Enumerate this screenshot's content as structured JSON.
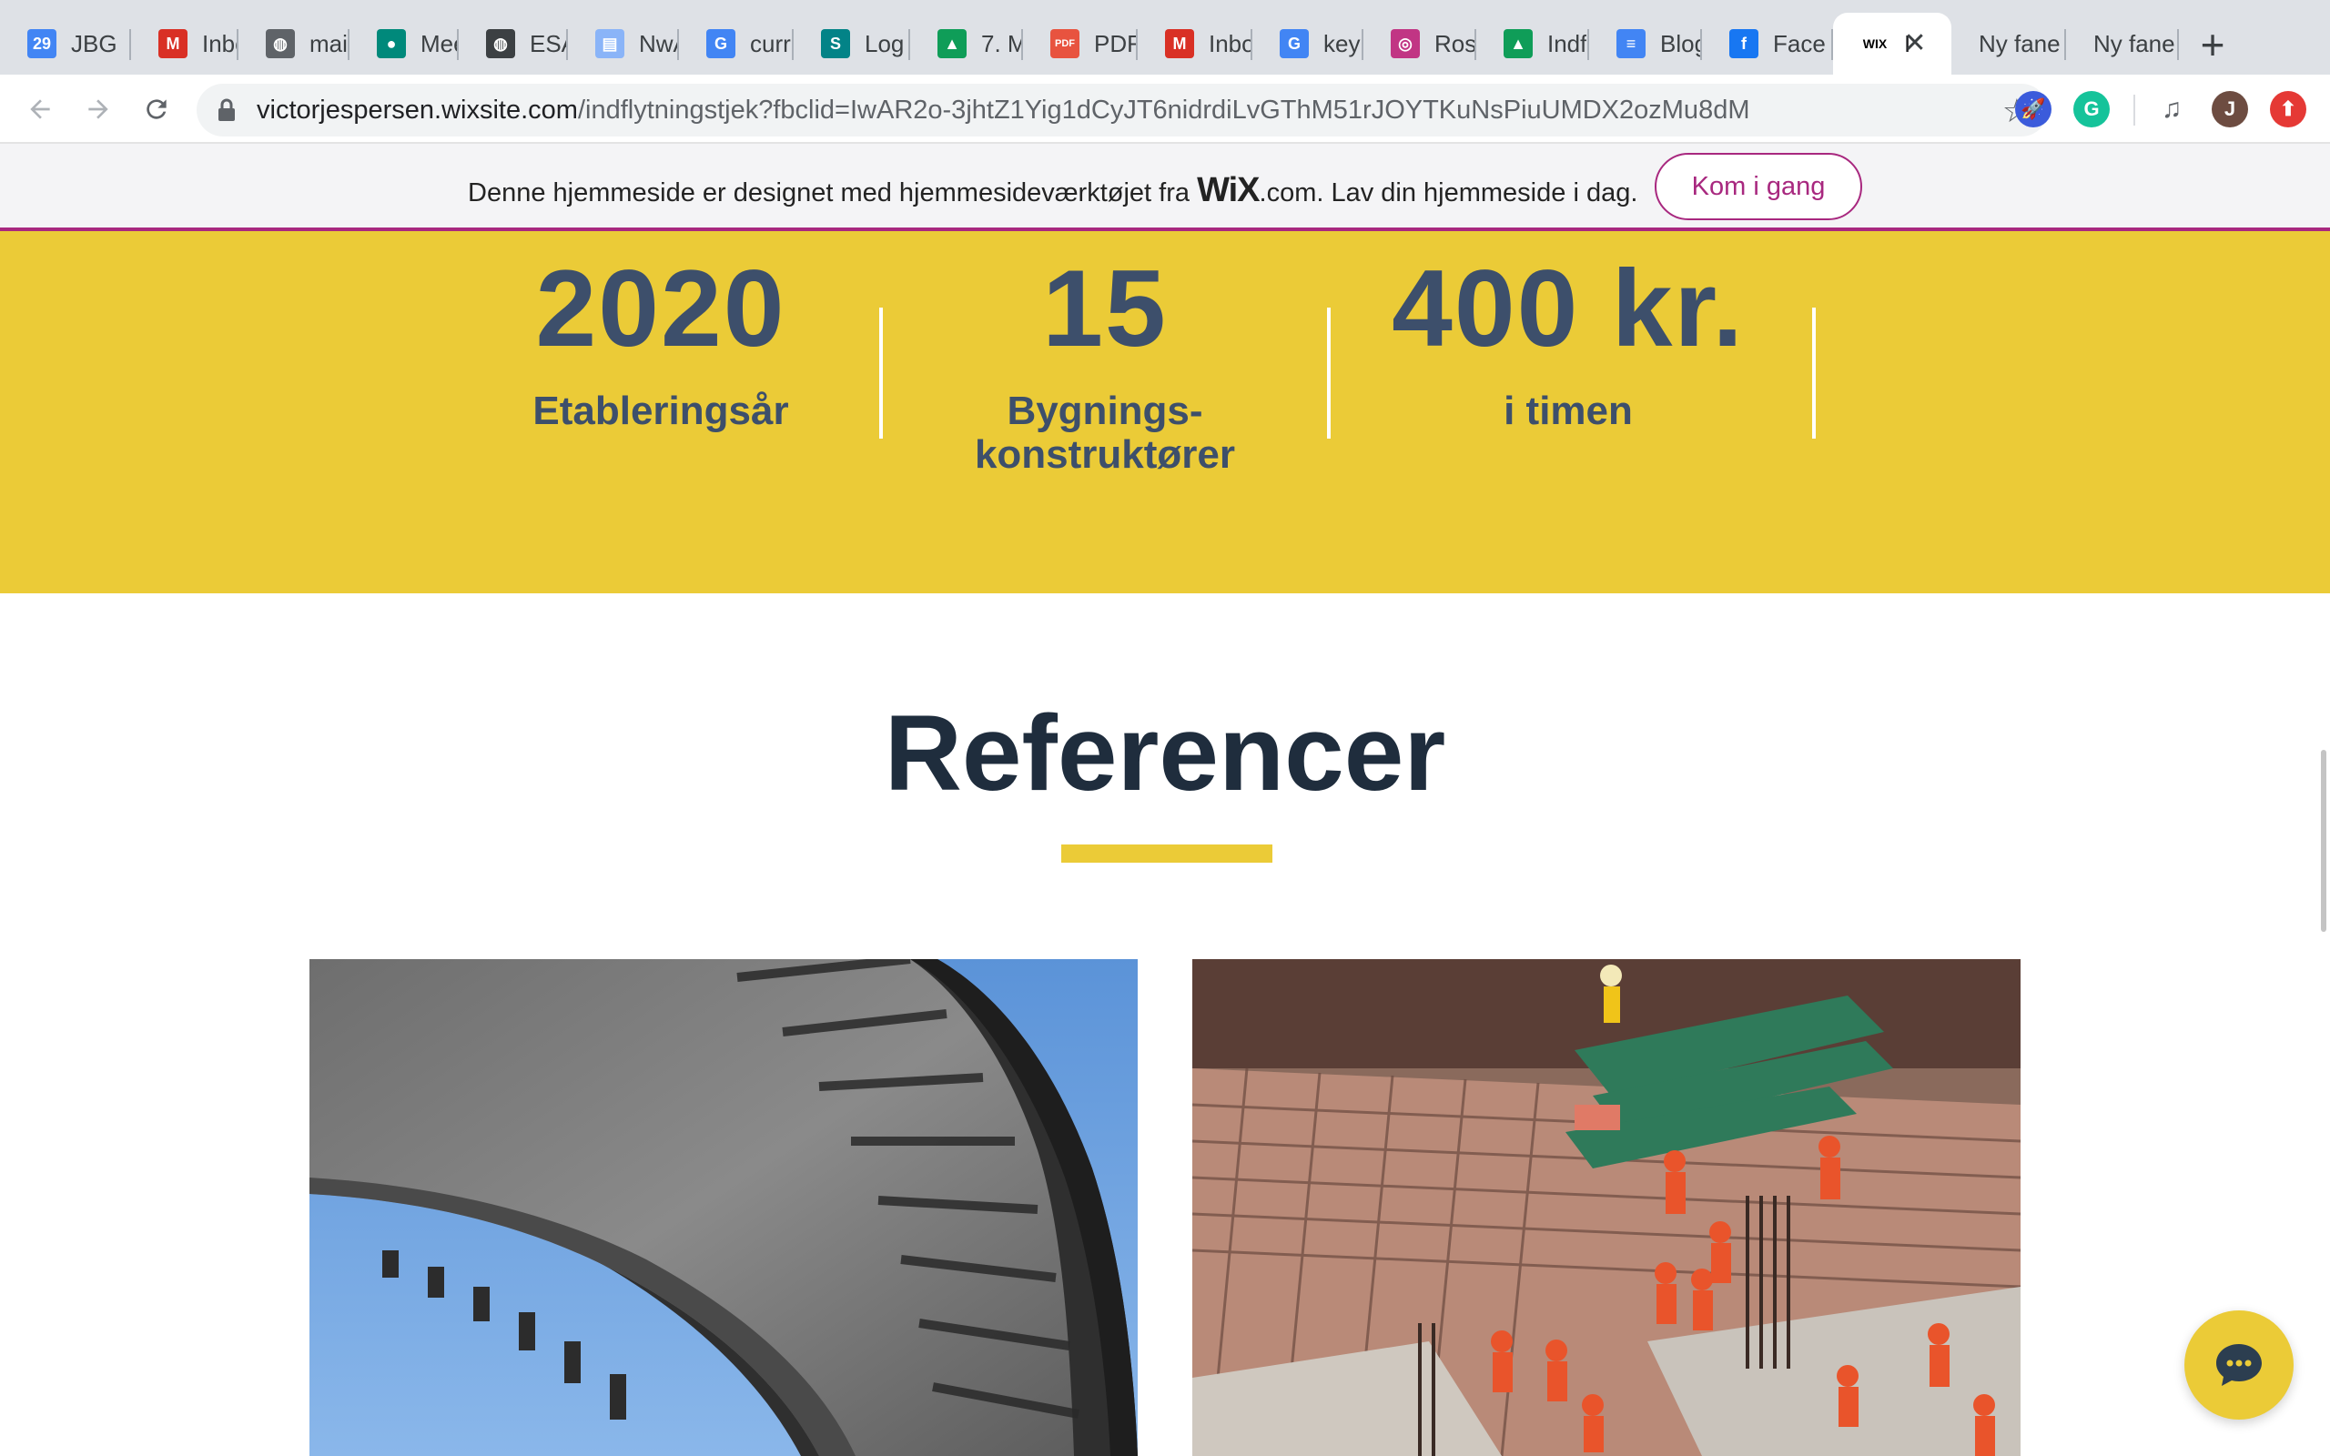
{
  "browser": {
    "tabs": [
      {
        "title": "JBG",
        "icon": "calendar-icon",
        "color": "#4285f4",
        "glyph": "29"
      },
      {
        "title": "Inbo",
        "icon": "gmail-icon",
        "color": "#d93025",
        "glyph": "M"
      },
      {
        "title": "mail",
        "icon": "globe-icon",
        "color": "#5f6368",
        "glyph": "◍"
      },
      {
        "title": "Mee",
        "icon": "meet-icon",
        "color": "#00897b",
        "glyph": "●"
      },
      {
        "title": "ESA",
        "icon": "globe-icon",
        "color": "#3c4043",
        "glyph": "◍"
      },
      {
        "title": "NwA",
        "icon": "document-icon",
        "color": "#8ab4f8",
        "glyph": "▤"
      },
      {
        "title": "curr",
        "icon": "google-icon",
        "color": "#4285f4",
        "glyph": "G"
      },
      {
        "title": "Log",
        "icon": "sharepoint-icon",
        "color": "#038387",
        "glyph": "S"
      },
      {
        "title": "7. M",
        "icon": "drive-icon",
        "color": "#0f9d58",
        "glyph": "▲"
      },
      {
        "title": "PDF",
        "icon": "pdf-icon",
        "color": "#e8533f",
        "glyph": "PDF"
      },
      {
        "title": "Inbo",
        "icon": "gmail-icon",
        "color": "#d93025",
        "glyph": "M"
      },
      {
        "title": "keyl",
        "icon": "google-icon",
        "color": "#4285f4",
        "glyph": "G"
      },
      {
        "title": "Ros",
        "icon": "instagram-icon",
        "color": "#c13584",
        "glyph": "◎"
      },
      {
        "title": "Indf",
        "icon": "drive-icon",
        "color": "#0f9d58",
        "glyph": "▲"
      },
      {
        "title": "Blog",
        "icon": "docs-icon",
        "color": "#4285f4",
        "glyph": "≡"
      },
      {
        "title": "Face",
        "icon": "facebook-icon",
        "color": "#1877f2",
        "glyph": "f"
      },
      {
        "title": "I",
        "icon": "wix-icon",
        "color": "#000000",
        "glyph": "WIX",
        "active": true
      },
      {
        "title": "Ny fane",
        "icon": "",
        "color": "",
        "glyph": ""
      },
      {
        "title": "Ny fane",
        "icon": "",
        "color": "",
        "glyph": ""
      }
    ],
    "url_host": "victorjespersen.wixsite.com",
    "url_path": "/indflytningstjek?fbclid=IwAR2o-3jhtZ1Yig1dCyJT6nidrdiLvGThM51rJOYTKuNsPiuUMDX2ozMu8dM",
    "profile_initial": "J"
  },
  "wix_banner": {
    "text_before": "Denne hjemmeside er designet med hjemmesideværktøjet fra ",
    "logo": "WiX",
    "text_after": ".com. Lav din hjemmeside i dag.",
    "button": "Kom i gang",
    "accent": "#a8287f"
  },
  "stats": [
    {
      "number": "2020",
      "label": "Etableringsår"
    },
    {
      "number": "15",
      "label": "Bygnings- konstruktører"
    },
    {
      "number": "400 kr.",
      "label": "i timen"
    }
  ],
  "colors": {
    "yellow": "#ebcb37",
    "navy": "#3d4f6b"
  },
  "references": {
    "title": "Referencer",
    "photos": [
      {
        "name": "bridge-photo"
      },
      {
        "name": "construction-site-photo"
      }
    ]
  }
}
